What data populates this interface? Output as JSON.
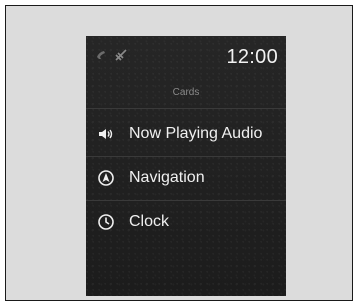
{
  "status": {
    "time": "12:00",
    "icons": [
      "phone-icon",
      "no-signal-icon"
    ]
  },
  "cards_title": "Cards",
  "menu": [
    {
      "label": "Now Playing Audio",
      "icon": "speaker-icon"
    },
    {
      "label": "Navigation",
      "icon": "navigation-icon"
    },
    {
      "label": "Clock",
      "icon": "clock-icon"
    }
  ]
}
